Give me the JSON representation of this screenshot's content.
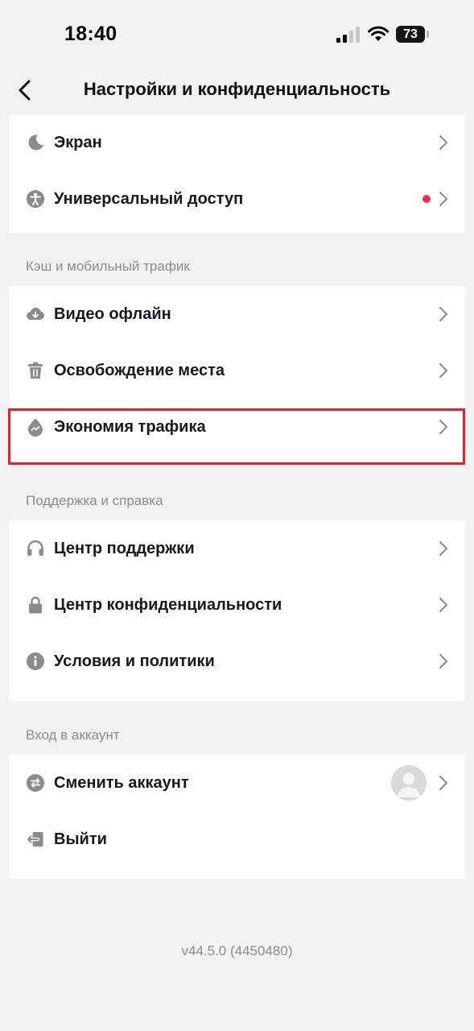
{
  "status_bar": {
    "time": "18:40",
    "battery": "73"
  },
  "header": {
    "title": "Настройки и конфиденциальность"
  },
  "display_section": {
    "items": [
      {
        "label": "Экран",
        "icon": "moon-icon"
      },
      {
        "label": "Универсальный доступ",
        "icon": "accessibility-icon"
      }
    ]
  },
  "cache_section": {
    "title": "Кэш и мобильный трафик",
    "items": [
      {
        "label": "Видео офлайн",
        "icon": "cloud-download-icon"
      },
      {
        "label": "Освобождение места",
        "icon": "trash-icon"
      },
      {
        "label": "Экономия трафика",
        "icon": "data-saver-icon"
      }
    ]
  },
  "support_section": {
    "title": "Поддержка и справка",
    "items": [
      {
        "label": "Центр поддержки",
        "icon": "headset-icon"
      },
      {
        "label": "Центр конфиденциальности",
        "icon": "lock-icon"
      },
      {
        "label": "Условия и политики",
        "icon": "info-icon"
      }
    ]
  },
  "account_section": {
    "title": "Вход в аккаунт",
    "items": [
      {
        "label": "Сменить аккаунт",
        "icon": "switch-account-icon"
      },
      {
        "label": "Выйти",
        "icon": "logout-icon"
      }
    ]
  },
  "footer": {
    "version": "v44.5.0 (4450480)"
  },
  "colors": {
    "background": "#f2f2f2",
    "card": "#ffffff",
    "icon": "#8a8b91",
    "notification_dot": "#fe2c55",
    "highlight": "#e0242f"
  }
}
